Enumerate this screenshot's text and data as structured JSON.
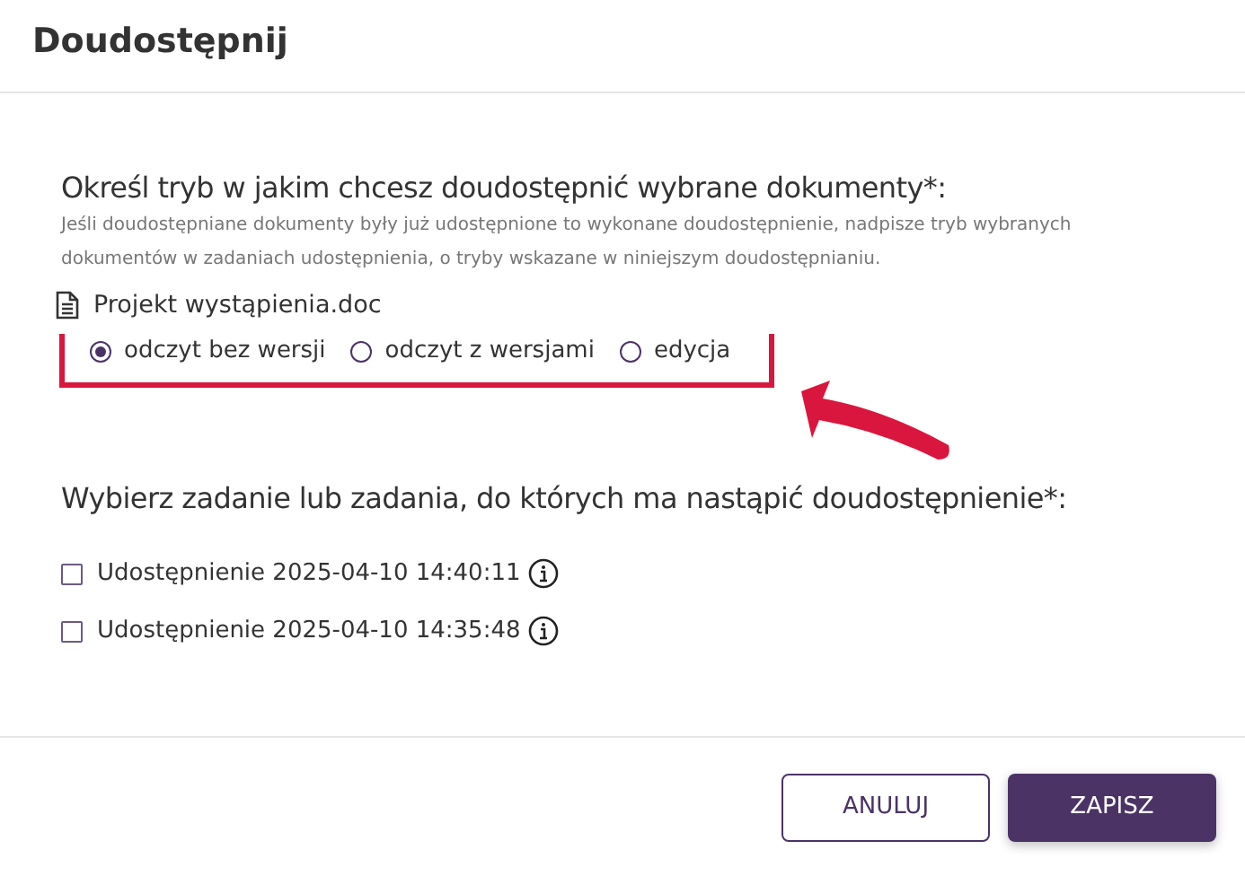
{
  "dialog": {
    "title": "Doudostępnij"
  },
  "mode_section": {
    "heading": "Określ tryb w jakim chcesz doudostępnić wybrane dokumenty*:",
    "hint": "Jeśli doudostępniane dokumenty były już udostępnione to wykonane doudostępnienie, nadpisze tryb wybranych dokumentów w zadaniach udostępnienia, o tryby wskazane w niniejszym doudostępnianiu.",
    "document": "Projekt wystąpienia.doc",
    "options": [
      {
        "label": "odczyt bez wersji",
        "selected": true
      },
      {
        "label": "odczyt z wersjami",
        "selected": false
      },
      {
        "label": "edycja",
        "selected": false
      }
    ]
  },
  "task_section": {
    "heading": "Wybierz zadanie lub zadania, do których ma nastąpić doudostępnienie*:",
    "tasks": [
      {
        "label": "Udostępnienie 2025-04-10 14:40:11",
        "checked": false
      },
      {
        "label": "Udostępnienie 2025-04-10 14:35:48",
        "checked": false
      }
    ]
  },
  "buttons": [
    {
      "label": "ANULUJ",
      "kind": "secondary"
    },
    {
      "label": "ZAPISZ",
      "kind": "primary"
    }
  ]
}
